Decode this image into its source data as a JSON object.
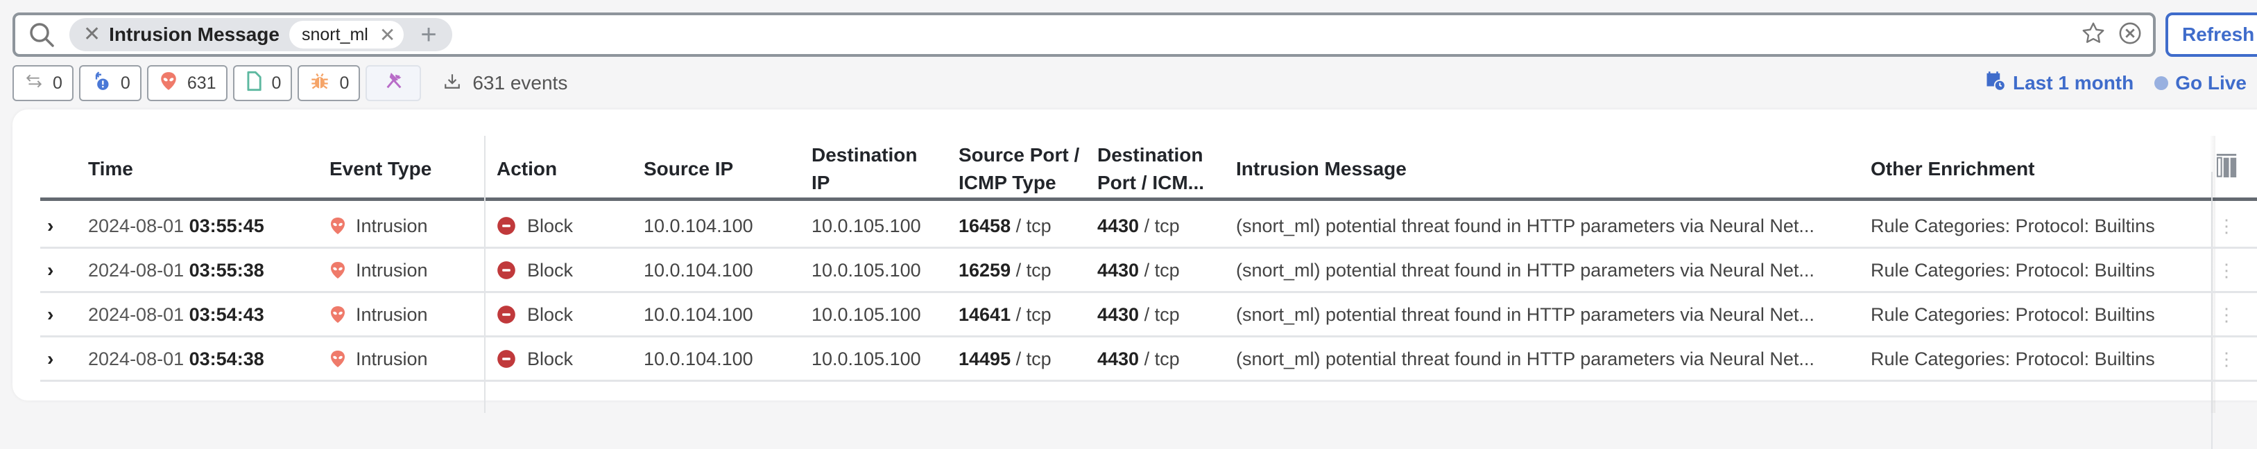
{
  "search": {
    "filter_field": "Intrusion Message",
    "filter_value": "snort_ml",
    "placeholder": ""
  },
  "toolbar": {
    "refresh_label": "Refresh",
    "time_range_label": "Last 1 month",
    "go_live_label": "Go Live",
    "events_count_label": "631 events"
  },
  "chips": [
    {
      "icon": "connection-icon",
      "count": "0"
    },
    {
      "icon": "indication-of-compromise-icon",
      "count": "0"
    },
    {
      "icon": "intrusion-alien-icon",
      "count": "631"
    },
    {
      "icon": "file-icon",
      "count": "0"
    },
    {
      "icon": "malware-bug-icon",
      "count": "0"
    },
    {
      "icon": "tools-icon",
      "count": ""
    }
  ],
  "colors": {
    "accent": "#3f6ccb",
    "intrusion": "#ef7a6a",
    "block": "#c0393b",
    "file": "#5db8a0",
    "malware": "#f5a468",
    "tools": "#b86cc8"
  },
  "table": {
    "columns": [
      {
        "key": "time",
        "label": "Time"
      },
      {
        "key": "event_type",
        "label": "Event Type"
      },
      {
        "key": "action",
        "label": "Action"
      },
      {
        "key": "source_ip",
        "label": "Source IP"
      },
      {
        "key": "destination_ip",
        "label": "Destination IP"
      },
      {
        "key": "source_port",
        "label": "Source Port / ICMP Type"
      },
      {
        "key": "destination_port",
        "label": "Destination Port / ICM..."
      },
      {
        "key": "intrusion_message",
        "label": "Intrusion Message"
      },
      {
        "key": "other_enrichment",
        "label": "Other Enrichment"
      }
    ],
    "rows": [
      {
        "date": "2024-08-01",
        "time": "03:55:45",
        "event_type": "Intrusion",
        "action": "Block",
        "source_ip": "10.0.104.100",
        "destination_ip": "10.0.105.100",
        "source_port": "16458",
        "source_proto": "/ tcp",
        "destination_port": "4430",
        "destination_proto": "/ tcp",
        "intrusion_message": "(snort_ml) potential threat found in HTTP parameters via Neural Net...",
        "other_enrichment": "Rule Categories: Protocol: Builtins"
      },
      {
        "date": "2024-08-01",
        "time": "03:55:38",
        "event_type": "Intrusion",
        "action": "Block",
        "source_ip": "10.0.104.100",
        "destination_ip": "10.0.105.100",
        "source_port": "16259",
        "source_proto": "/ tcp",
        "destination_port": "4430",
        "destination_proto": "/ tcp",
        "intrusion_message": "(snort_ml) potential threat found in HTTP parameters via Neural Net...",
        "other_enrichment": "Rule Categories: Protocol: Builtins"
      },
      {
        "date": "2024-08-01",
        "time": "03:54:43",
        "event_type": "Intrusion",
        "action": "Block",
        "source_ip": "10.0.104.100",
        "destination_ip": "10.0.105.100",
        "source_port": "14641",
        "source_proto": "/ tcp",
        "destination_port": "4430",
        "destination_proto": "/ tcp",
        "intrusion_message": "(snort_ml) potential threat found in HTTP parameters via Neural Net...",
        "other_enrichment": "Rule Categories: Protocol: Builtins"
      },
      {
        "date": "2024-08-01",
        "time": "03:54:38",
        "event_type": "Intrusion",
        "action": "Block",
        "source_ip": "10.0.104.100",
        "destination_ip": "10.0.105.100",
        "source_port": "14495",
        "source_proto": "/ tcp",
        "destination_port": "4430",
        "destination_proto": "/ tcp",
        "intrusion_message": "(snort_ml) potential threat found in HTTP parameters via Neural Net...",
        "other_enrichment": "Rule Categories: Protocol: Builtins"
      }
    ]
  }
}
